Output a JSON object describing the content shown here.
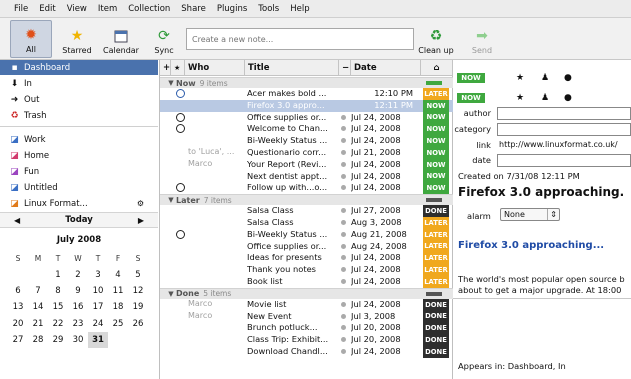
{
  "menu": [
    "File",
    "Edit",
    "View",
    "Item",
    "Collection",
    "Share",
    "Plugins",
    "Tools",
    "Help"
  ],
  "toolbar": {
    "all": "All",
    "starred": "Starred",
    "calendar": "Calendar",
    "sync": "Sync",
    "new_note_placeholder": "Create a new note...",
    "cleanup": "Clean up",
    "send": "Send"
  },
  "sidebar": {
    "items": [
      "Dashboard",
      "In",
      "Out",
      "Trash",
      "Work",
      "Home",
      "Fun",
      "Untitled",
      "Linux Format..."
    ]
  },
  "calendar": {
    "today": "Today",
    "prev": "◀",
    "next": "▶",
    "month": "July 2008",
    "dow": [
      "S",
      "M",
      "T",
      "W",
      "T",
      "F",
      "S"
    ],
    "days": [
      "",
      "",
      "1",
      "2",
      "3",
      "4",
      "5",
      "6",
      "7",
      "8",
      "9",
      "10",
      "11",
      "12",
      "13",
      "14",
      "15",
      "16",
      "17",
      "18",
      "19",
      "20",
      "21",
      "22",
      "23",
      "24",
      "25",
      "26",
      "27",
      "28",
      "29",
      "30",
      "31",
      "",
      ""
    ],
    "today_day": "31"
  },
  "list": {
    "headers": {
      "plus": "+",
      "star": "★",
      "who": "Who",
      "title": "Title",
      "minus": "−",
      "date": "Date",
      "sort": "⌂"
    },
    "groups": [
      {
        "name": "Now",
        "count": "9 items"
      },
      {
        "name": "Later",
        "count": "7 items"
      },
      {
        "name": "Done",
        "count": "5 items"
      }
    ],
    "now_rows": [
      {
        "who": "",
        "title": "Acer makes bold ...",
        "date": "12:10 PM",
        "status": "LATER"
      },
      {
        "who": "",
        "title": "Firefox 3.0 appro...",
        "date": "12:11 PM",
        "status": "NOW"
      },
      {
        "who": "",
        "title": "Office supplies or...",
        "date": "Jul 24, 2008",
        "status": "NOW"
      },
      {
        "who": "",
        "title": "Welcome to Chan...",
        "date": "Jul 24, 2008",
        "status": "NOW"
      },
      {
        "who": "",
        "title": "Bi-Weekly Status ...",
        "date": "Jul 24, 2008",
        "status": "NOW"
      },
      {
        "who": "to 'Luca', ...",
        "title": "Questionario corr...",
        "date": "Jul 21, 2008",
        "status": "NOW"
      },
      {
        "who": "Marco",
        "title": "Your Report (Revi...",
        "date": "Jul 24, 2008",
        "status": "NOW"
      },
      {
        "who": "",
        "title": "Next dentist appt...",
        "date": "Jul 24, 2008",
        "status": "NOW"
      },
      {
        "who": "",
        "title": "Follow up with...o...",
        "date": "Jul 24, 2008",
        "status": "NOW"
      }
    ],
    "later_rows": [
      {
        "who": "",
        "title": "Salsa Class",
        "date": "Jul 27, 2008",
        "status": "DONE"
      },
      {
        "who": "",
        "title": "Salsa Class",
        "date": "Aug 3, 2008",
        "status": "LATER"
      },
      {
        "who": "",
        "title": "Bi-Weekly Status ...",
        "date": "Aug 21, 2008",
        "status": "LATER"
      },
      {
        "who": "",
        "title": "Office supplies or...",
        "date": "Aug 24, 2008",
        "status": "LATER"
      },
      {
        "who": "",
        "title": "Ideas for presents",
        "date": "Jul 24, 2008",
        "status": "LATER"
      },
      {
        "who": "",
        "title": "Thank you notes",
        "date": "Jul 24, 2008",
        "status": "LATER"
      },
      {
        "who": "",
        "title": "Book list",
        "date": "Jul 24, 2008",
        "status": "LATER"
      }
    ],
    "done_rows": [
      {
        "who": "Marco",
        "title": "Movie list",
        "date": "Jul 24, 2008",
        "status": "DONE"
      },
      {
        "who": "Marco",
        "title": "New Event",
        "date": "Jul 3, 2008",
        "status": "DONE"
      },
      {
        "who": "",
        "title": "Brunch potluck...",
        "date": "Jul 20, 2008",
        "status": "DONE"
      },
      {
        "who": "",
        "title": "Class Trip: Exhibit...",
        "date": "Jul 20, 2008",
        "status": "DONE"
      },
      {
        "who": "",
        "title": "Download Chandl...",
        "date": "Jul 24, 2008",
        "status": "DONE"
      }
    ]
  },
  "detail": {
    "badge": "NOW",
    "author_label": "author",
    "category_label": "category",
    "link_label": "link",
    "link_value": "http://www.linuxformat.co.uk/",
    "date_label": "date",
    "created": "Created on 7/31/08 12:11 PM",
    "title": "Firefox 3.0 approaching.",
    "alarm_label": "alarm",
    "alarm_value": "None",
    "body_title": "Firefox 3.0 approaching...",
    "body_line1": "The world's most popular open source b",
    "body_line2": "about to get a major upgrade. At 18:00",
    "appears_in": "Appears in: Dashboard, In"
  }
}
